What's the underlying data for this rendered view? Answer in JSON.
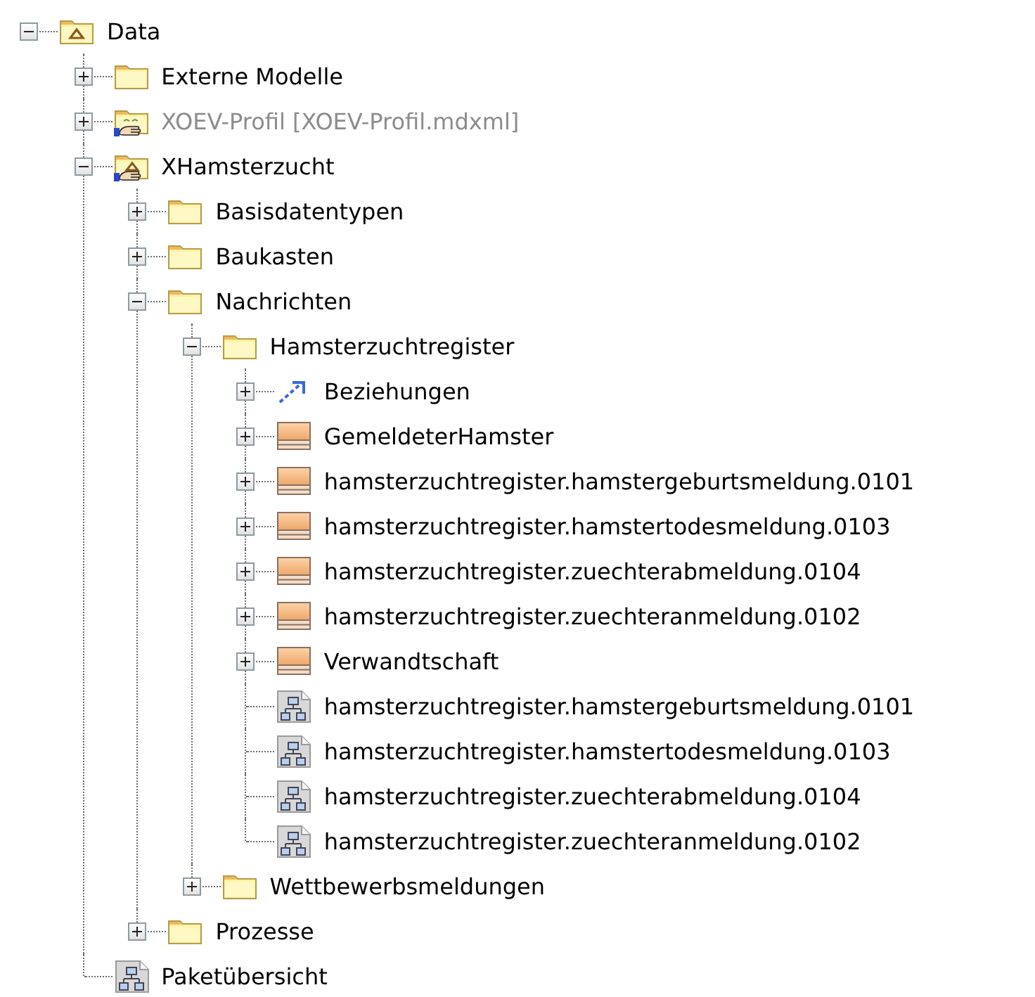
{
  "tree": [
    {
      "kind": "package",
      "label": "Data",
      "expanded": true,
      "disabled": false,
      "children": [
        {
          "kind": "folder",
          "label": "Externe Modelle",
          "expanded": false,
          "disabled": false
        },
        {
          "kind": "profile",
          "label": "XOEV-Profil [XOEV-Profil.mdxml]",
          "expanded": false,
          "disabled": true
        },
        {
          "kind": "model",
          "label": "XHamsterzucht",
          "expanded": true,
          "disabled": false,
          "children": [
            {
              "kind": "folder",
              "label": "Basisdatentypen",
              "expanded": false,
              "disabled": false
            },
            {
              "kind": "folder",
              "label": "Baukasten",
              "expanded": false,
              "disabled": false
            },
            {
              "kind": "folder",
              "label": "Nachrichten",
              "expanded": true,
              "disabled": false,
              "children": [
                {
                  "kind": "folder",
                  "label": "Hamsterzuchtregister",
                  "expanded": true,
                  "disabled": false,
                  "children": [
                    {
                      "kind": "relation",
                      "label": "Beziehungen",
                      "expanded": false,
                      "disabled": false
                    },
                    {
                      "kind": "class",
                      "label": "GemeldeterHamster",
                      "expanded": false,
                      "disabled": false
                    },
                    {
                      "kind": "class",
                      "label": "hamsterzuchtregister.hamstergeburtsmeldung.0101",
                      "expanded": false,
                      "disabled": false
                    },
                    {
                      "kind": "class",
                      "label": "hamsterzuchtregister.hamstertodesmeldung.0103",
                      "expanded": false,
                      "disabled": false
                    },
                    {
                      "kind": "class",
                      "label": "hamsterzuchtregister.zuechterabmeldung.0104",
                      "expanded": false,
                      "disabled": false
                    },
                    {
                      "kind": "class",
                      "label": "hamsterzuchtregister.zuechteranmeldung.0102",
                      "expanded": false,
                      "disabled": false
                    },
                    {
                      "kind": "class",
                      "label": "Verwandtschaft",
                      "expanded": false,
                      "disabled": false
                    },
                    {
                      "kind": "diagram",
                      "label": "hamsterzuchtregister.hamstergeburtsmeldung.0101",
                      "disabled": false
                    },
                    {
                      "kind": "diagram",
                      "label": "hamsterzuchtregister.hamstertodesmeldung.0103",
                      "disabled": false
                    },
                    {
                      "kind": "diagram",
                      "label": "hamsterzuchtregister.zuechterabmeldung.0104",
                      "disabled": false
                    },
                    {
                      "kind": "diagram",
                      "label": "hamsterzuchtregister.zuechteranmeldung.0102",
                      "disabled": false
                    }
                  ]
                },
                {
                  "kind": "folder",
                  "label": "Wettbewerbsmeldungen",
                  "expanded": false,
                  "disabled": false
                }
              ]
            },
            {
              "kind": "folder",
              "label": "Prozesse",
              "expanded": false,
              "disabled": false
            }
          ]
        },
        {
          "kind": "diagram",
          "label": "Paketübersicht",
          "disabled": false
        }
      ]
    }
  ]
}
